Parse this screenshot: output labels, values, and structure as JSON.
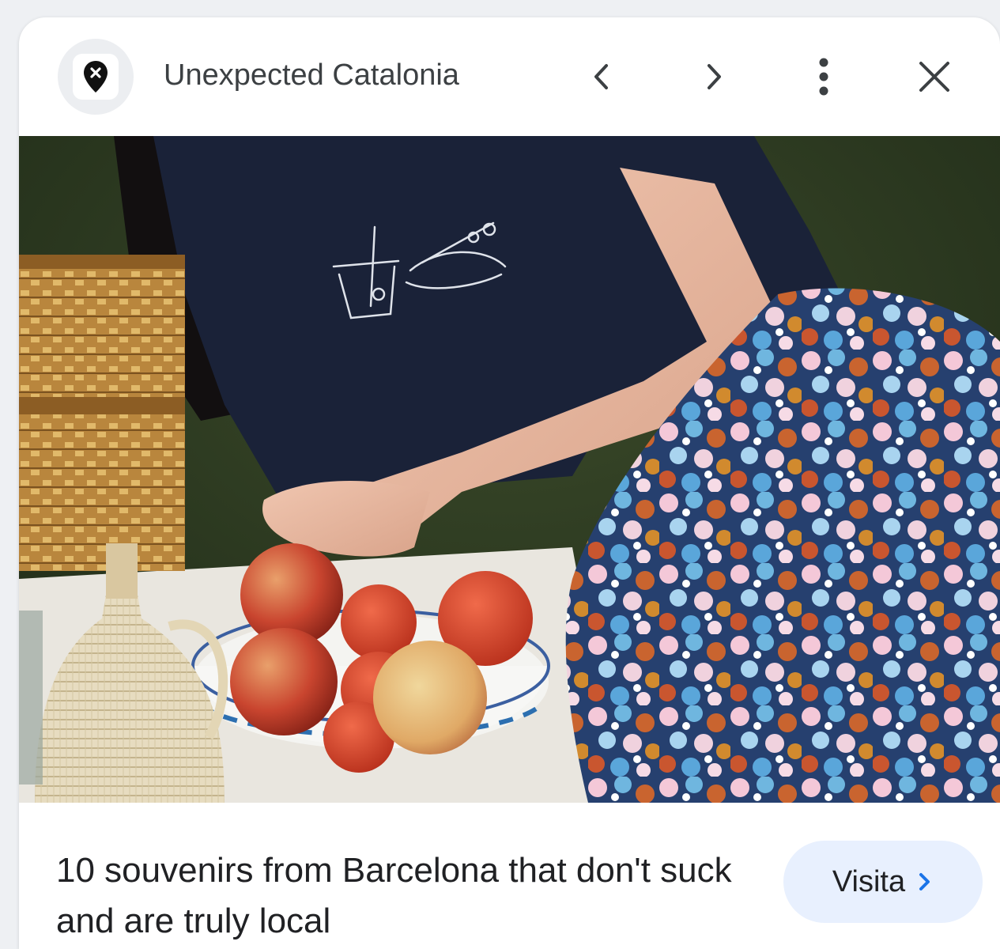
{
  "header": {
    "site_name": "Unexpected Catalonia",
    "favicon_icon": "map-pin-icon",
    "prev_icon": "chevron-left-icon",
    "next_icon": "chevron-right-icon",
    "more_icon": "more-vert-icon",
    "close_icon": "close-icon"
  },
  "image": {
    "lens_icon": "google-lens-icon"
  },
  "footer": {
    "caption": "10 souvenirs from Barcelona that don't suck and are truly local",
    "visit_label": "Visita",
    "visit_icon": "chevron-right-icon"
  },
  "colors": {
    "visit_bg": "#e8f0fe",
    "accent": "#1a73e8"
  }
}
